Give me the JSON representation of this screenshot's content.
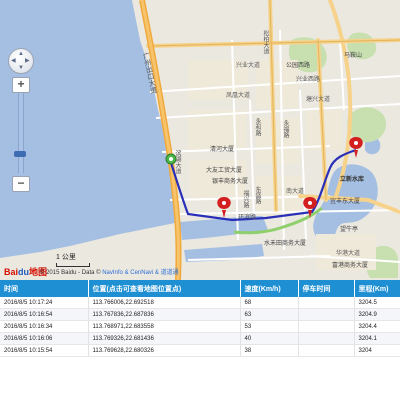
{
  "map": {
    "zoom_in": "+",
    "zoom_out": "−",
    "pan": {
      "up": "▲",
      "down": "▼",
      "left": "◀",
      "right": "▶"
    },
    "scale_label": "1 公里",
    "logo_bai": "Bai",
    "logo_du": "du",
    "logo_map": "地图",
    "copyright_prefix": "© 2015 Baidu - Data ©",
    "copyright_links": "NavInfo & CenNavi & 道道通",
    "labels": {
      "port": "广州出口大道",
      "binhu": "滨湖大道",
      "songbai": "松柏大道",
      "xingye1": "兴业大道",
      "xingye2": "兴业西路",
      "fenghuang": "凤凰大道",
      "park": "公园西路",
      "mashan": "马鞍山",
      "tanglin": "塘兴大道",
      "qinghe": "清河大厦",
      "dayou": "大友工贸大厦",
      "yinfeng": "银丰商务大厦",
      "yonghe": "永和路",
      "yongfu": "永福路",
      "dongsheng": "东盛路",
      "nanlu": "南大道",
      "fuxing": "福兴路",
      "huanbin": "环滨路",
      "lidi": "立新水库",
      "yifeng": "宜丰东大厦",
      "shuiwo": "水禾田商务大厦",
      "wangniu": "望牛亭",
      "fugang": "富港商务大厦",
      "huagang": "华港大道"
    }
  },
  "table": {
    "headers": [
      "时间",
      "位置(点击可查看地图位置点)",
      "速度(Km/h)",
      "停车时间",
      "里程(Km)"
    ],
    "rows": [
      [
        "2016/8/5 10:17:24",
        "113.766006,22.692518",
        "68",
        "",
        "3204.5"
      ],
      [
        "2016/8/5 10:16:54",
        "113.767836,22.687836",
        "63",
        "",
        "3204.9"
      ],
      [
        "2016/8/5 10:16:34",
        "113.768971,22.683558",
        "53",
        "",
        "3204.4"
      ],
      [
        "2016/8/5 10:16:06",
        "113.769326,22.681436",
        "40",
        "",
        "3204.1"
      ],
      [
        "2016/8/5 10:15:54",
        "113.769628,22.680326",
        "38",
        "",
        "3204"
      ]
    ]
  }
}
